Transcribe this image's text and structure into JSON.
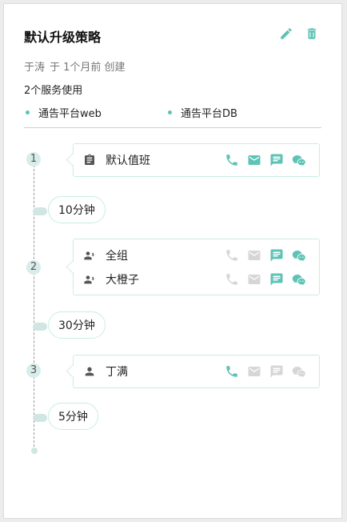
{
  "policy": {
    "title": "默认升级策略",
    "creator": "于涛",
    "created_time": "于 1个月前 创建",
    "service_count": "2个服务使用",
    "services": [
      "通告平台web",
      "通告平台DB"
    ]
  },
  "steps": [
    {
      "number": "1",
      "targets": [
        {
          "name": "默认值班",
          "icon": "clipboard-icon",
          "channels": {
            "phone": true,
            "email": true,
            "sms": true,
            "wechat": true
          }
        }
      ]
    },
    {
      "number": "2",
      "targets": [
        {
          "name": "全组",
          "icon": "group-icon",
          "channels": {
            "phone": false,
            "email": false,
            "sms": true,
            "wechat": true
          }
        },
        {
          "name": "大橙子",
          "icon": "group-icon",
          "channels": {
            "phone": false,
            "email": false,
            "sms": true,
            "wechat": true
          }
        }
      ]
    },
    {
      "number": "3",
      "targets": [
        {
          "name": "丁满",
          "icon": "user-icon",
          "channels": {
            "phone": true,
            "email": false,
            "sms": false,
            "wechat": false
          }
        }
      ]
    }
  ],
  "delays": [
    "10分钟",
    "30分钟",
    "5分钟"
  ],
  "colors": {
    "accent": "#5dc3b6",
    "disabled": "#d6d6d6"
  }
}
